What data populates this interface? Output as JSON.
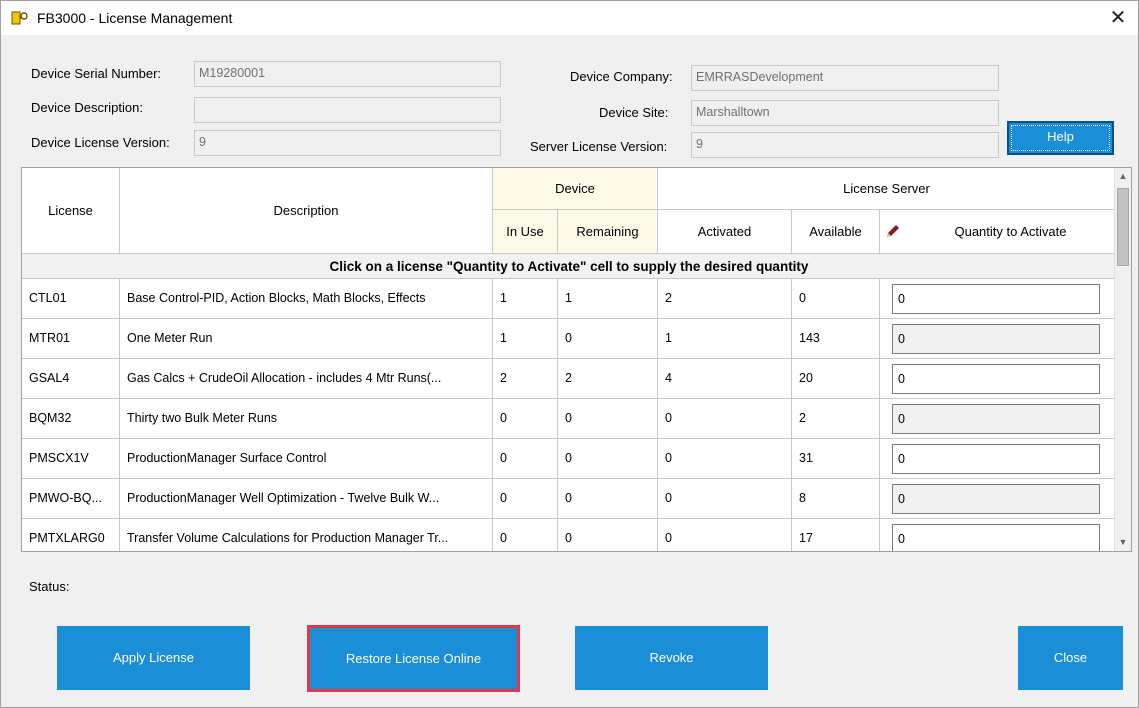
{
  "window": {
    "title": "FB3000 - License Management",
    "close_glyph": "✕"
  },
  "device": {
    "serial_label": "Device Serial Number:",
    "serial_value": "M19280001",
    "description_label": "Device Description:",
    "description_value": "",
    "license_version_label": "Device License Version:",
    "license_version_value": "9",
    "company_label": "Device Company:",
    "company_value": "EMRRASDevelopment",
    "site_label": "Device Site:",
    "site_value": "Marshalltown",
    "server_version_label": "Server License Version:",
    "server_version_value": "9"
  },
  "help_label": "Help",
  "grid": {
    "headers": {
      "license": "License",
      "description": "Description",
      "device_group": "Device",
      "license_server_group": "License Server",
      "in_use": "In Use",
      "remaining": "Remaining",
      "activated": "Activated",
      "available": "Available",
      "quantity": "Quantity to Activate",
      "edit_icon": "pencil-icon"
    },
    "hint": "Click on a license \"Quantity to Activate\" cell to supply the desired quantity",
    "rows": [
      {
        "license": "CTL01",
        "description": "Base Control-PID, Action Blocks, Math Blocks, Effects",
        "in_use": "1",
        "remaining": "1",
        "activated": "2",
        "available": "0",
        "quantity": "0"
      },
      {
        "license": "MTR01",
        "description": "One Meter Run",
        "in_use": "1",
        "remaining": "0",
        "activated": "1",
        "available": "143",
        "quantity": "0"
      },
      {
        "license": "GSAL4",
        "description": "Gas Calcs + CrudeOil Allocation - includes 4 Mtr Runs(...",
        "in_use": "2",
        "remaining": "2",
        "activated": "4",
        "available": "20",
        "quantity": "0"
      },
      {
        "license": "BQM32",
        "description": "Thirty two Bulk Meter Runs",
        "in_use": "0",
        "remaining": "0",
        "activated": "0",
        "available": "2",
        "quantity": "0"
      },
      {
        "license": "PMSCX1V",
        "description": "ProductionManager Surface Control",
        "in_use": "0",
        "remaining": "0",
        "activated": "0",
        "available": "31",
        "quantity": "0"
      },
      {
        "license": "PMWO-BQ...",
        "description": "ProductionManager Well Optimization - Twelve Bulk W...",
        "in_use": "0",
        "remaining": "0",
        "activated": "0",
        "available": "8",
        "quantity": "0"
      },
      {
        "license": "PMTXLARG0",
        "description": "Transfer Volume Calculations for Production Manager Tr...",
        "in_use": "0",
        "remaining": "0",
        "activated": "0",
        "available": "17",
        "quantity": "0"
      }
    ]
  },
  "status_label": "Status:",
  "buttons": {
    "apply": "Apply License",
    "restore": "Restore License Online",
    "revoke": "Revoke",
    "close": "Close"
  },
  "colors": {
    "button_blue": "#1a8fd8",
    "highlight_red": "#e0394b",
    "device_header_bg": "#fdfbe8"
  }
}
